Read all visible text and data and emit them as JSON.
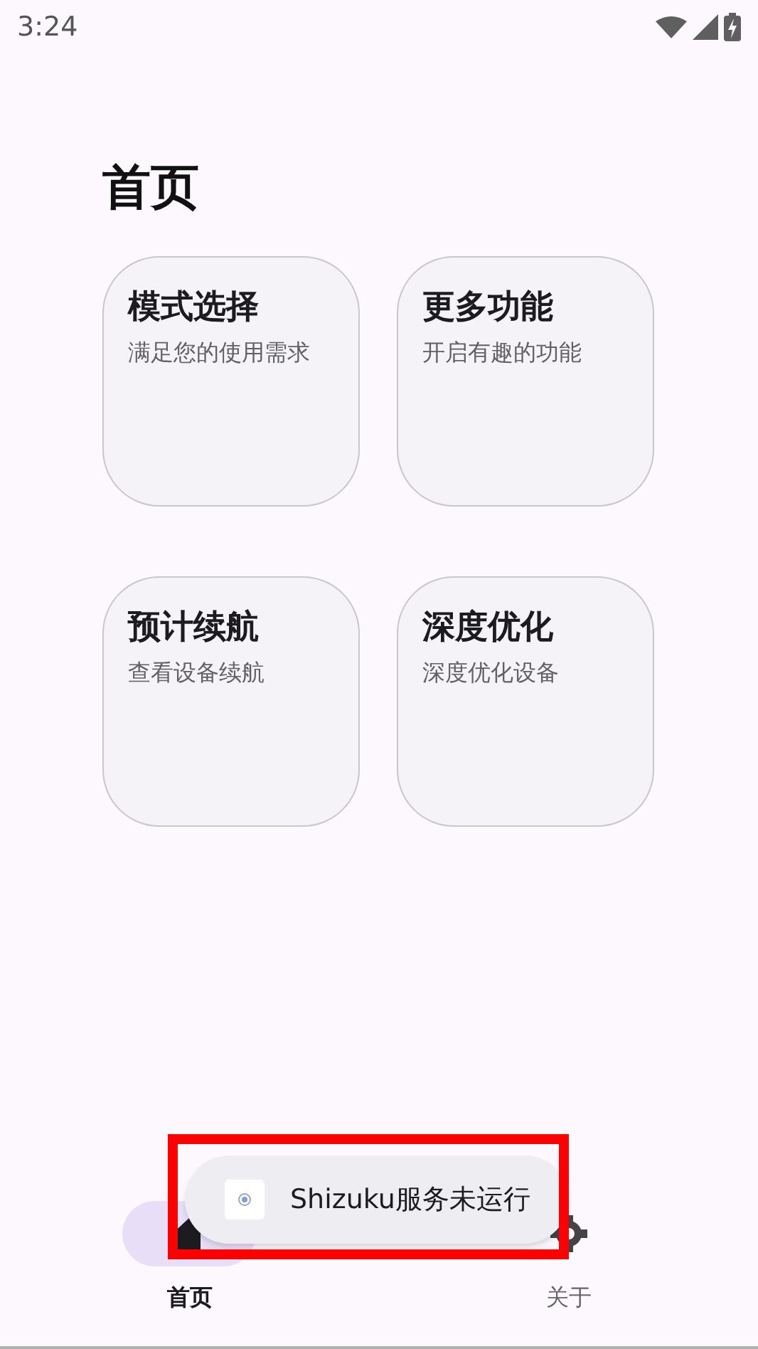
{
  "status_bar": {
    "time": "3:24"
  },
  "page": {
    "title": "首页"
  },
  "cards": [
    {
      "title": "模式选择",
      "subtitle": "满足您的使用需求"
    },
    {
      "title": "更多功能",
      "subtitle": "开启有趣的功能"
    },
    {
      "title": "预计续航",
      "subtitle": "查看设备续航"
    },
    {
      "title": "深度优化",
      "subtitle": "深度优化设备"
    }
  ],
  "bottom_nav": [
    {
      "kind": "home",
      "label": "首页",
      "selected": true
    },
    {
      "kind": "settings",
      "label": "关于",
      "selected": false
    }
  ],
  "toast": {
    "text": "Shizuku服务未运行"
  },
  "annotation": {
    "kind": "highlight-box"
  }
}
